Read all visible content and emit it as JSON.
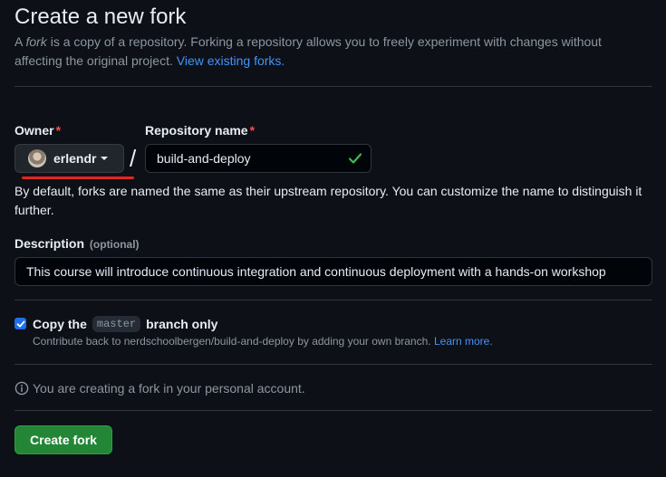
{
  "header": {
    "title": "Create a new fork",
    "intro_a": "A ",
    "intro_fork": "fork",
    "intro_b": " is a copy of a repository. Forking a repository allows you to freely experiment with changes without affecting the original project. ",
    "view_forks_link": "View existing forks."
  },
  "owner": {
    "label": "Owner",
    "required_mark": "*",
    "value": "erlendr"
  },
  "repository": {
    "label": "Repository name",
    "required_mark": "*",
    "value": "build-and-deploy",
    "separator": "/",
    "valid": true
  },
  "name_help": "By default, forks are named the same as their upstream repository. You can customize the name to distinguish it further.",
  "description": {
    "label": "Description",
    "optional_tag": "(optional)",
    "value": "This course will introduce continuous integration and continuous deployment with a hands-on workshop"
  },
  "copy_branch": {
    "checked": true,
    "label_a": "Copy the",
    "branch": "master",
    "label_b": "branch only",
    "note": "Contribute back to nerdschoolbergen/build-and-deploy by adding your own branch.",
    "learn_more": "Learn more."
  },
  "info": {
    "text": "You are creating a fork in your personal account."
  },
  "actions": {
    "create_label": "Create fork"
  },
  "colors": {
    "background": "#0d1117",
    "link": "#4493f8",
    "required": "#f85149",
    "primary_button": "#238636",
    "checkbox": "#1f6feb",
    "valid_check": "#3fb950"
  }
}
